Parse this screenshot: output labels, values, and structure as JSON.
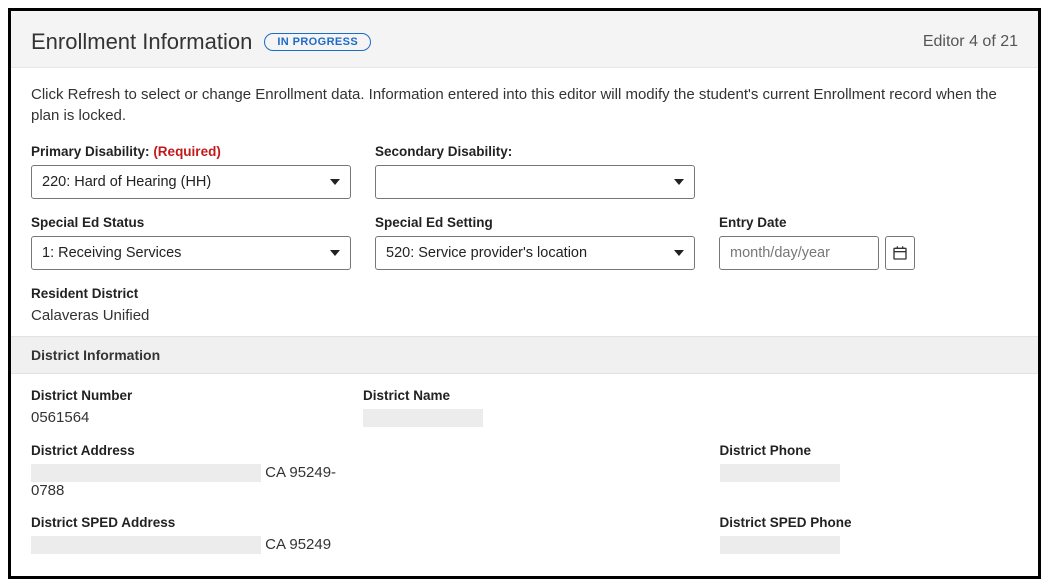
{
  "header": {
    "title": "Enrollment Information",
    "status": "IN PROGRESS",
    "counter": "Editor 4 of 21"
  },
  "intro": "Click Refresh to select or change Enrollment data. Information entered into this editor will modify the student's current Enrollment record when the plan is locked.",
  "fields": {
    "primary_disability": {
      "label": "Primary Disability:",
      "required_text": "(Required)",
      "value": "220: Hard of Hearing (HH)"
    },
    "secondary_disability": {
      "label": "Secondary Disability:",
      "value": ""
    },
    "sped_status": {
      "label": "Special Ed Status",
      "value": "1: Receiving Services"
    },
    "sped_setting": {
      "label": "Special Ed Setting",
      "value": "520: Service provider's location"
    },
    "entry_date": {
      "label": "Entry Date",
      "placeholder": "month/day/year"
    },
    "resident_district": {
      "label": "Resident District",
      "value": "Calaveras Unified"
    }
  },
  "district_info": {
    "section_title": "District Information",
    "number": {
      "label": "District Number",
      "value": "0561564"
    },
    "name": {
      "label": "District Name",
      "value": ""
    },
    "address": {
      "label": "District Address",
      "suffix": "CA 95249-0788"
    },
    "phone": {
      "label": "District Phone",
      "value": ""
    },
    "sped_address": {
      "label": "District SPED Address",
      "suffix": "CA 95249"
    },
    "sped_phone": {
      "label": "District SPED Phone",
      "value": ""
    }
  }
}
